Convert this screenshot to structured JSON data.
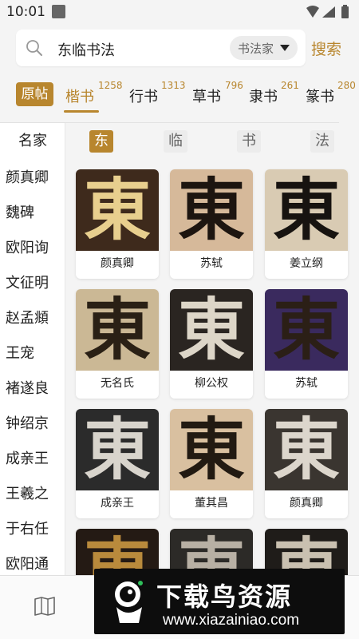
{
  "status_bar": {
    "time": "10:01"
  },
  "search": {
    "query": "东临书法",
    "filter_label": "书法家",
    "button_label": "搜索"
  },
  "tabs": {
    "original_label": "原帖",
    "items": [
      {
        "label": "楷书",
        "count": "1258"
      },
      {
        "label": "行书",
        "count": "1313"
      },
      {
        "label": "草书",
        "count": "796"
      },
      {
        "label": "隶书",
        "count": "261"
      },
      {
        "label": "篆书",
        "count": "280"
      }
    ]
  },
  "sidebar": {
    "header": "名家",
    "items": [
      "颜真卿",
      "魏碑",
      "欧阳询",
      "文征明",
      "赵孟頫",
      "王宠",
      "褚遂良",
      "钟绍京",
      "成亲王",
      "王羲之",
      "于右任",
      "欧阳通"
    ]
  },
  "char_filter": [
    "东",
    "临",
    "书",
    "法"
  ],
  "cards": [
    {
      "glyph": "東",
      "name": "颜真卿",
      "bg": "#3e2a1c",
      "fg": "#e8cf8e"
    },
    {
      "glyph": "東",
      "name": "苏轼",
      "bg": "#d6b99a",
      "fg": "#1d1510"
    },
    {
      "glyph": "東",
      "name": "姜立纲",
      "bg": "#d9cbb3",
      "fg": "#171310"
    },
    {
      "glyph": "東",
      "name": "无名氏",
      "bg": "#cbb895",
      "fg": "#2a2015"
    },
    {
      "glyph": "東",
      "name": "柳公权",
      "bg": "#2a2521",
      "fg": "#ddd6c8"
    },
    {
      "glyph": "東",
      "name": "苏轼",
      "bg": "#3a2a5e",
      "fg": "#2b1f16"
    },
    {
      "glyph": "東",
      "name": "成亲王",
      "bg": "#2b2b2b",
      "fg": "#d8d4cc"
    },
    {
      "glyph": "東",
      "name": "董其昌",
      "bg": "#d9c0a0",
      "fg": "#221a12"
    },
    {
      "glyph": "東",
      "name": "颜真卿",
      "bg": "#3a3530",
      "fg": "#dcd6cc"
    },
    {
      "glyph": "東",
      "name": "",
      "bg": "#241a14",
      "fg": "#b98a3c"
    },
    {
      "glyph": "東",
      "name": "",
      "bg": "#2c2a27",
      "fg": "#b8b0a4"
    },
    {
      "glyph": "東",
      "name": "",
      "bg": "#1f1c19",
      "fg": "#c9c0b0"
    }
  ],
  "watermark": {
    "title": "下载鸟资源",
    "url": "www.xiazainiao.com"
  },
  "colors": {
    "accent": "#b8862e",
    "background": "#f4f4f4"
  }
}
